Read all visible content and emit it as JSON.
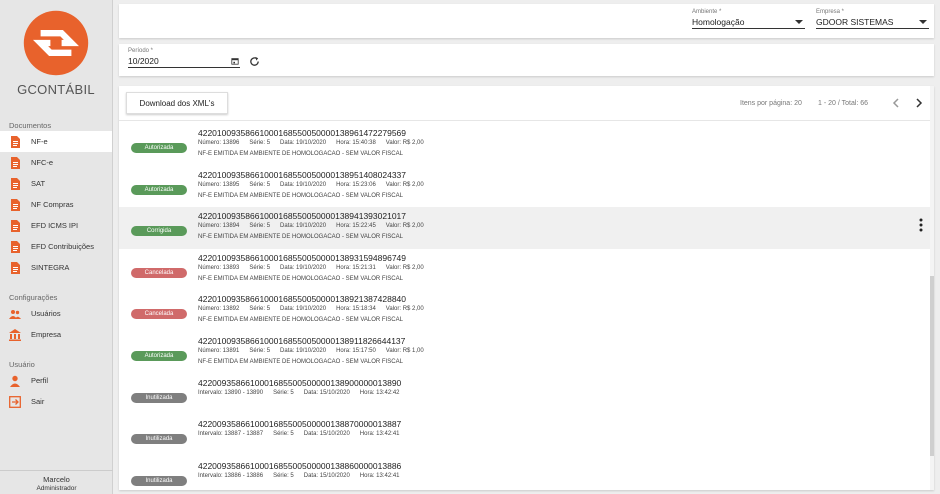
{
  "brand": {
    "name": "GCONTÁBIL",
    "accent": "#e8622c"
  },
  "sidebar": {
    "sections": [
      {
        "title": "Documentos",
        "items": [
          {
            "label": "NF-e",
            "icon": "file-icon",
            "active": true
          },
          {
            "label": "NFC-e",
            "icon": "file-icon"
          },
          {
            "label": "SAT",
            "icon": "file-icon"
          },
          {
            "label": "NF Compras",
            "icon": "file-icon"
          },
          {
            "label": "EFD ICMS IPI",
            "icon": "file-icon"
          },
          {
            "label": "EFD Contribuições",
            "icon": "file-icon"
          },
          {
            "label": "SINTEGRA",
            "icon": "file-icon"
          }
        ]
      },
      {
        "title": "Configurações",
        "items": [
          {
            "label": "Usuários",
            "icon": "users-icon"
          },
          {
            "label": "Empresa",
            "icon": "bank-icon"
          }
        ]
      },
      {
        "title": "Usuário",
        "items": [
          {
            "label": "Perfil",
            "icon": "person-icon"
          },
          {
            "label": "Sair",
            "icon": "exit-icon"
          }
        ]
      }
    ],
    "footer": {
      "name": "Marcelo",
      "role": "Administrador"
    }
  },
  "topbar": {
    "ambiente": {
      "label": "Ambiente *",
      "value": "Homologação"
    },
    "empresa": {
      "label": "Empresa *",
      "value": "GDOOR SISTEMAS"
    }
  },
  "filter": {
    "periodo_label": "Período *",
    "periodo_value": "10/2020"
  },
  "list": {
    "download_label": "Download dos XML's",
    "per_page": "Itens por página: 20",
    "range": "1 - 20 / Total: 66",
    "rows": [
      {
        "status": "Autorizada",
        "kind": "aut",
        "key": "42201009358661000168550050000138961472279569",
        "meta": [
          "Número: 13896",
          "Série: 5",
          "Data: 19/10/2020",
          "Hora: 15:40:38",
          "Valor: R$ 2,00"
        ],
        "obs": "NF-E EMITIDA EM AMBIENTE DE HOMOLOGACAO - SEM VALOR FISCAL"
      },
      {
        "status": "Autorizada",
        "kind": "aut",
        "key": "42201009358661000168550050000138951408024337",
        "meta": [
          "Número: 13895",
          "Série: 5",
          "Data: 19/10/2020",
          "Hora: 15:23:06",
          "Valor: R$ 2,00"
        ],
        "obs": "NF-E EMITIDA EM AMBIENTE DE HOMOLOGACAO - SEM VALOR FISCAL"
      },
      {
        "status": "Corrigida",
        "kind": "cor",
        "key": "42201009358661000168550050000138941393021017",
        "meta": [
          "Número: 13894",
          "Série: 5",
          "Data: 19/10/2020",
          "Hora: 15:22:45",
          "Valor: R$ 2,00"
        ],
        "obs": "NF-E EMITIDA EM AMBIENTE DE HOMOLOGACAO - SEM VALOR FISCAL",
        "highlight": true
      },
      {
        "status": "Cancelada",
        "kind": "can",
        "key": "42201009358661000168550050000138931594896749",
        "meta": [
          "Número: 13893",
          "Série: 5",
          "Data: 19/10/2020",
          "Hora: 15:21:31",
          "Valor: R$ 2,00"
        ],
        "obs": "NF-E EMITIDA EM AMBIENTE DE HOMOLOGACAO - SEM VALOR FISCAL"
      },
      {
        "status": "Cancelada",
        "kind": "can",
        "key": "42201009358661000168550050000138921387428840",
        "meta": [
          "Número: 13892",
          "Série: 5",
          "Data: 19/10/2020",
          "Hora: 15:18:34",
          "Valor: R$ 2,00"
        ],
        "obs": "NF-E EMITIDA EM AMBIENTE DE HOMOLOGACAO - SEM VALOR FISCAL"
      },
      {
        "status": "Autorizada",
        "kind": "aut",
        "key": "42201009358661000168550050000138911826644137",
        "meta": [
          "Número: 13891",
          "Série: 5",
          "Data: 19/10/2020",
          "Hora: 15:17:50",
          "Valor: R$ 1,00"
        ],
        "obs": "NF-E EMITIDA EM AMBIENTE DE HOMOLOGACAO - SEM VALOR FISCAL"
      },
      {
        "status": "Inutilizada",
        "kind": "inu",
        "key": "4220093586610001685500500000138900000013890",
        "meta": [
          "Intervalo: 13890 - 13890",
          "Série: 5",
          "Data: 15/10/2020",
          "Hora: 13:42:42"
        ],
        "obs": ""
      },
      {
        "status": "Inutilizada",
        "kind": "inu",
        "key": "4220093586610001685500500000138870000013887",
        "meta": [
          "Intervalo: 13887 - 13887",
          "Série: 5",
          "Data: 15/10/2020",
          "Hora: 13:42:41"
        ],
        "obs": ""
      },
      {
        "status": "Inutilizada",
        "kind": "inu",
        "key": "4220093586610001685500500000138860000013886",
        "meta": [
          "Intervalo: 13886 - 13886",
          "Série: 5",
          "Data: 15/10/2020",
          "Hora: 13:42:41"
        ],
        "obs": ""
      }
    ]
  }
}
